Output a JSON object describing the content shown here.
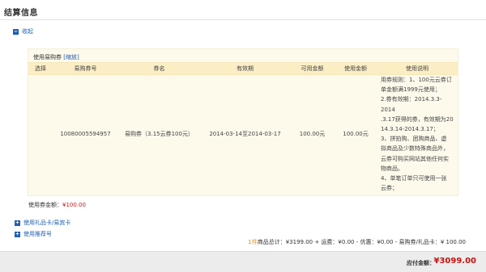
{
  "section": {
    "title": "结算信息"
  },
  "collapse_toggle": {
    "icon": "minus-square-icon",
    "label": "收起"
  },
  "coupon_panel": {
    "header_text": "使用易购券 ",
    "header_link": "[缩放]",
    "columns": [
      "选择",
      "易购券号",
      "券名",
      "有效期",
      "可用金额",
      "使用金额",
      "使用说明"
    ],
    "rows": [
      {
        "select": "",
        "coupon_no": "10080005594957",
        "name": "易购券（3.15云券100元）",
        "validity": "2014-03-14至2014-03-17",
        "available": "100.00元",
        "used": "100.00元",
        "desc_lines": [
          "用券规则：1、100元云券订",
          "单金额满1999元使用；",
          "2.券有效期：2014.3.3-2014",
          ".3.17获得的券，有效期为20",
          "14.3.14-2014.3.17；",
          "3、拼拍购、团购商品、虚",
          "拟商品及少数特殊商品外，",
          "云券可购买网站其他任何实",
          "物商品。",
          "4、单笔订单只可使用一张",
          "云券；"
        ]
      }
    ]
  },
  "used_total": {
    "label": "使用券金额：",
    "amount": "¥100.00"
  },
  "gift_card_toggle": {
    "icon": "plus-square-icon",
    "label": "使用礼品卡/易宾卡"
  },
  "referrer_toggle": {
    "icon": "plus-square-icon",
    "label": "使用推荐号"
  },
  "summary": {
    "count": "1件",
    "text": "商品总计：¥3199.00 + 运费：¥0.00 - 优惠：¥0.00 - 易购券/礼品卡：¥ 100.00"
  },
  "footer": {
    "pay_label": "应付金额：",
    "pay_amount": "¥3099.00"
  },
  "colors": {
    "link": "#1f5fb0",
    "price": "#c71313",
    "panel_bg": "#fdfaec",
    "header_bg": "#fbeec5",
    "footer_bg": "#ececec"
  }
}
